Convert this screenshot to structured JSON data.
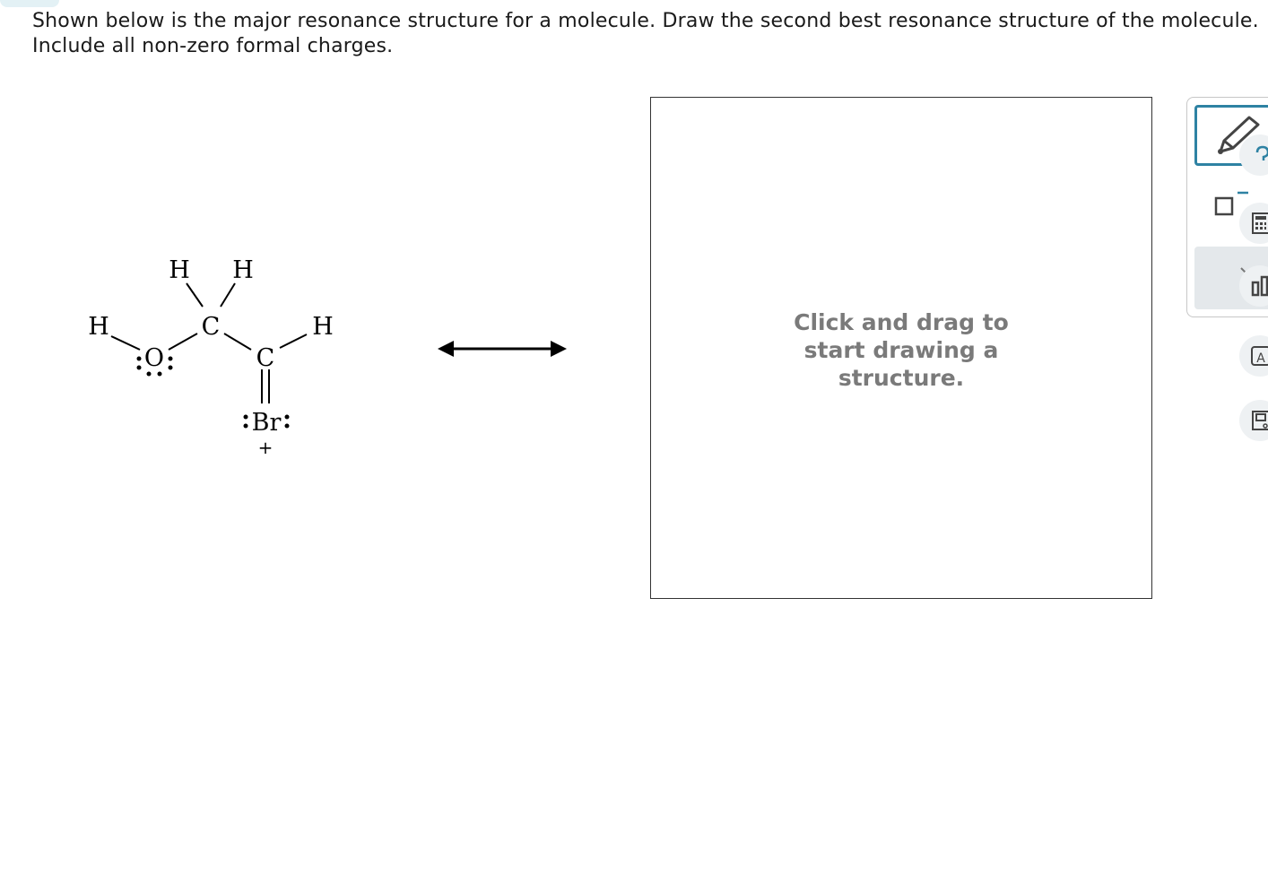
{
  "question": {
    "line1": "Shown below is the major resonance structure for a molecule. Draw the second best resonance structure of the molecule.",
    "line2": "Include all non-zero formal charges."
  },
  "molecule": {
    "atoms": {
      "h_top_left": "H",
      "h_top_right": "H",
      "h_left": "H",
      "o": "O",
      "c_top": "C",
      "c_right": "C",
      "h_right": "H",
      "br": "Br",
      "plus": "+"
    }
  },
  "canvas": {
    "hint": "Click and drag to\nstart drawing a\nstructure."
  },
  "toolbar": {
    "tools": [
      "pencil-icon",
      "charge-icon",
      "eraser-icon"
    ]
  },
  "side_buttons": [
    "help-icon",
    "calculator-icon",
    "data-icon",
    "periodic-table-icon",
    "book-icon"
  ],
  "colors": {
    "accent": "#2e82a3",
    "hint_text": "#7a7a7a",
    "tool_selected_bg": "#e4e8eb"
  }
}
